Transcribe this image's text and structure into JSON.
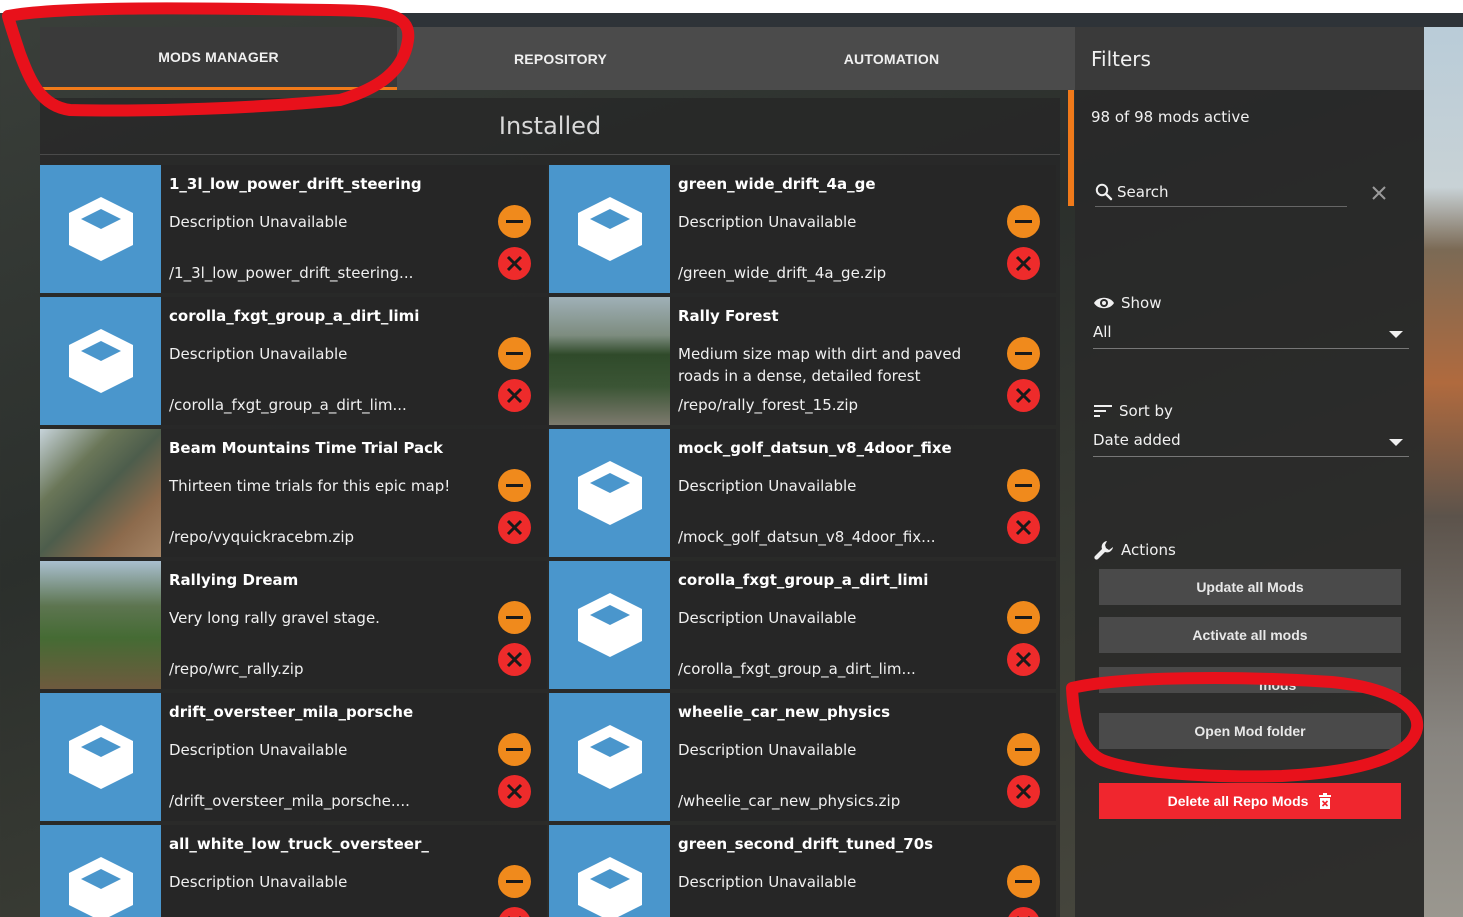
{
  "tabs": [
    {
      "label": "MODS MANAGER",
      "active": true
    },
    {
      "label": "REPOSITORY",
      "active": false
    },
    {
      "label": "AUTOMATION",
      "active": false
    }
  ],
  "main": {
    "title": "Installed",
    "mods": [
      {
        "name": "1_3l_low_power_drift_steering",
        "description": "Description Unavailable",
        "path": "/1_3l_low_power_drift_steering...",
        "thumb": "cube-icon"
      },
      {
        "name": "green_wide_drift_4a_ge",
        "description": "Description Unavailable",
        "path": "/green_wide_drift_4a_ge.zip",
        "thumb": "cube-icon"
      },
      {
        "name": "corolla_fxgt_group_a_dirt_limi",
        "description": "Description Unavailable",
        "path": "/corolla_fxgt_group_a_dirt_lim...",
        "thumb": "cube-icon"
      },
      {
        "name": "Rally Forest",
        "description": "Medium size map with dirt and paved roads in a dense, detailed forest",
        "path": "/repo/rally_forest_15.zip",
        "thumb": "forest-photo"
      },
      {
        "name": "Beam Mountains Time Trial Pack",
        "description": "Thirteen time trials for this epic map!",
        "path": "/repo/vyquickracebm.zip",
        "thumb": "beam-photo"
      },
      {
        "name": "mock_golf_datsun_v8_4door_fixe",
        "description": "Description Unavailable",
        "path": "/mock_golf_datsun_v8_4door_fix...",
        "thumb": "cube-icon"
      },
      {
        "name": "Rallying Dream",
        "description": "Very long rally gravel stage.",
        "path": "/repo/wrc_rally.zip",
        "thumb": "rally-photo"
      },
      {
        "name": "corolla_fxgt_group_a_dirt_limi",
        "description": "Description Unavailable",
        "path": "/corolla_fxgt_group_a_dirt_lim...",
        "thumb": "cube-icon"
      },
      {
        "name": "drift_oversteer_mila_porsche",
        "description": "Description Unavailable",
        "path": "/drift_oversteer_mila_porsche....",
        "thumb": "cube-icon"
      },
      {
        "name": "wheelie_car_new_physics",
        "description": "Description Unavailable",
        "path": "/wheelie_car_new_physics.zip",
        "thumb": "cube-icon"
      },
      {
        "name": "all_white_low_truck_oversteer_",
        "description": "Description Unavailable",
        "path": "",
        "thumb": "cube-icon"
      },
      {
        "name": "green_second_drift_tuned_70s",
        "description": "Description Unavailable",
        "path": "",
        "thumb": "cube-icon"
      }
    ]
  },
  "filters": {
    "title": "Filters",
    "active_count": "98 of 98 mods active",
    "search_placeholder": "Search",
    "show_label": "Show",
    "show_value": "All",
    "sort_label": "Sort by",
    "sort_value": "Date added",
    "actions_label": "Actions",
    "actions": {
      "update_all": "Update all Mods",
      "activate_all": "Activate all mods",
      "deactivate_all_partial": "mods",
      "open_folder": "Open Mod folder",
      "delete_repo": "Delete all Repo Mods"
    }
  },
  "colors": {
    "accent_orange": "#f07a1a",
    "danger_red": "#f0262e",
    "thumb_blue": "#4a96cc",
    "annotation_red": "#e8111b"
  }
}
